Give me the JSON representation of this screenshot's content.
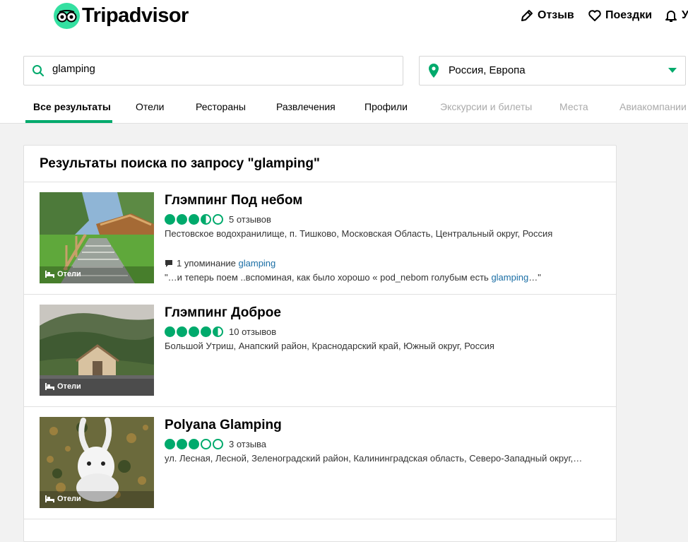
{
  "header": {
    "brand": "Tripadvisor",
    "nav": [
      {
        "label": "Отзыв"
      },
      {
        "label": "Поездки"
      },
      {
        "label": "У"
      }
    ]
  },
  "search": {
    "query": "glamping",
    "geo": "Россия, Европа"
  },
  "tabs": [
    {
      "label": "Все результаты"
    },
    {
      "label": "Отели"
    },
    {
      "label": "Рестораны"
    },
    {
      "label": "Развлечения"
    },
    {
      "label": "Профили"
    },
    {
      "label": "Экскурсии и билеты"
    },
    {
      "label": "Места"
    },
    {
      "label": "Авиакомпании"
    }
  ],
  "results_title": "Результаты поиска по запросу \"glamping\"",
  "results": [
    {
      "category": "Отели",
      "name": "Глэмпинг Под небом",
      "rating": 3.5,
      "reviews": "5 отзывов",
      "address": "Пестовское водохранилище, п. Тишково, Московская Область, Центральный округ, Россия",
      "mention_count": "1 упоминание",
      "mention_keyword": "glamping",
      "quote_before": "\"…и теперь поем ..вспоминая, как было хорошо « pod_nebom голубым есть ",
      "quote_keyword": "glamping",
      "quote_after": "…\""
    },
    {
      "category": "Отели",
      "name": "Глэмпинг Доброе",
      "rating": 4.5,
      "reviews": "10 отзывов",
      "address": "Большой Утриш, Анапский район, Краснодарский край, Южный округ, Россия"
    },
    {
      "category": "Отели",
      "name": "Polyana Glamping",
      "rating": 3,
      "reviews": "3 отзыва",
      "address": "ул. Лесная, Лесной, Зеленоградский район, Калининградская область, Северо-Западный округ,…"
    }
  ],
  "colors": {
    "accent": "#00aa6c",
    "logo": "#34e0a1",
    "link": "#1a6ea5"
  }
}
